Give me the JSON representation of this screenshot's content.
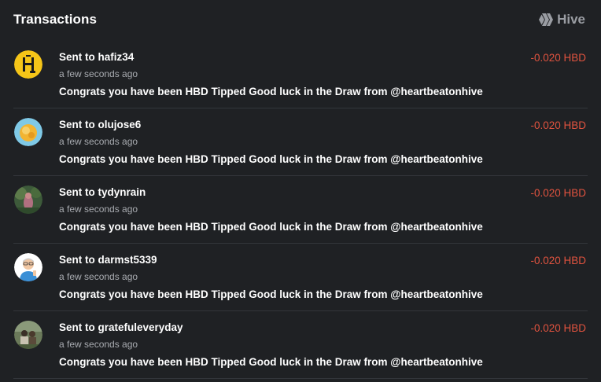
{
  "header": {
    "title": "Transactions",
    "brand_label": "Hive"
  },
  "colors": {
    "background": "#1f2124",
    "amount_negative": "#e0533f",
    "muted_text": "#a8abb0",
    "divider": "#33363b"
  },
  "transactions": [
    {
      "prefix": "Sent to ",
      "recipient": "hafiz34",
      "time": "a few seconds ago",
      "memo": "Congrats you have been HBD Tipped Good luck in the Draw from @heartbeatonhive",
      "amount": "-0.020 HBD",
      "avatar_icon": "yellow-logo-avatar"
    },
    {
      "prefix": "Sent to ",
      "recipient": "olujose6",
      "time": "a few seconds ago",
      "memo": "Congrats you have been HBD Tipped Good luck in the Draw from @heartbeatonhive",
      "amount": "-0.020 HBD",
      "avatar_icon": "orange-blue-avatar"
    },
    {
      "prefix": "Sent to ",
      "recipient": "tydynrain",
      "time": "a few seconds ago",
      "memo": "Congrats you have been HBD Tipped Good luck in the Draw from @heartbeatonhive",
      "amount": "-0.020 HBD",
      "avatar_icon": "nature-photo-avatar"
    },
    {
      "prefix": "Sent to ",
      "recipient": "darmst5339",
      "time": "a few seconds ago",
      "memo": "Congrats you have been HBD Tipped Good luck in the Draw from @heartbeatonhive",
      "amount": "-0.020 HBD",
      "avatar_icon": "cartoon-person-avatar"
    },
    {
      "prefix": "Sent to ",
      "recipient": "gratefuleveryday",
      "time": "a few seconds ago",
      "memo": "Congrats you have been HBD Tipped Good luck in the Draw from @heartbeatonhive",
      "amount": "-0.020 HBD",
      "avatar_icon": "outdoor-photo-avatar"
    }
  ]
}
